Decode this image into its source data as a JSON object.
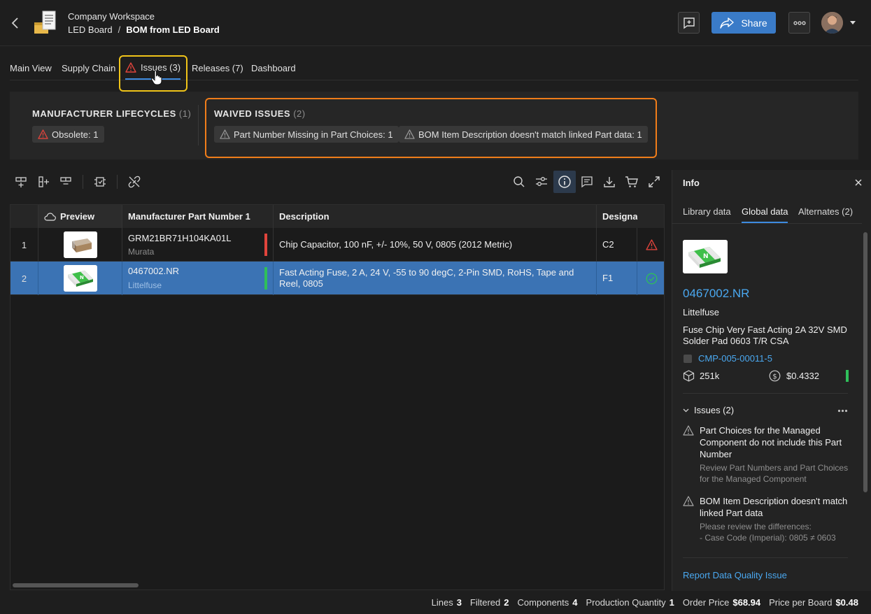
{
  "header": {
    "workspace": "Company Workspace",
    "project": "LED Board",
    "separator": "/",
    "document": "BOM from LED Board",
    "share_label": "Share"
  },
  "tabs": [
    {
      "label": "Main View"
    },
    {
      "label": "Supply Chain"
    },
    {
      "label": "Issues (3)"
    },
    {
      "label": "Releases (7)"
    },
    {
      "label": "Dashboard"
    }
  ],
  "summary": {
    "lifecycles_title": "MANUFACTURER LIFECYCLES",
    "lifecycles_count": "(1)",
    "lifecycle_chip": "Obsolete: 1",
    "waived_title": "WAIVED ISSUES",
    "waived_count": "(2)",
    "waived_chips": [
      "Part Number Missing in Part Choices: 1",
      "BOM Item Description doesn't match linked Part data: 1"
    ]
  },
  "table": {
    "columns": [
      "Preview",
      "Manufacturer Part Number 1",
      "Description",
      "Designat"
    ],
    "rows": [
      {
        "num": "1",
        "mpn": "GRM21BR71H104KA01L",
        "mfr": "Murata",
        "description": "Chip Capacitor, 100 nF, +/- 10%, 50 V, 0805 (2012 Metric)",
        "designator": "C2",
        "status": "error"
      },
      {
        "num": "2",
        "mpn": "0467002.NR",
        "mfr": "Littelfuse",
        "description": "Fast Acting Fuse, 2 A, 24 V, -55 to 90 degC, 2-Pin SMD, RoHS, Tape and Reel, 0805",
        "designator": "F1",
        "status": "ok"
      }
    ]
  },
  "info": {
    "title": "Info",
    "tabs": [
      "Library data",
      "Global data",
      "Alternates (2)"
    ],
    "part_number": "0467002.NR",
    "manufacturer": "Littelfuse",
    "description": "Fuse Chip Very Fast Acting 2A 32V SMD Solder Pad 0603 T/R CSA",
    "component_id": "CMP-005-00011-5",
    "stock": "251k",
    "price": "$0.4332",
    "issues_title": "Issues (2)",
    "issues": [
      {
        "title": "Part Choices for the Managed Component do not include this Part Number",
        "sub": "Review Part Numbers and Part Choices for the Managed Component"
      },
      {
        "title": "BOM Item Description doesn't match linked Part data",
        "sub": "Please review the differences:",
        "sub2": "- Case Code (Imperial): 0805 ≠ 0603"
      }
    ],
    "report_link": "Report Data Quality Issue"
  },
  "footer": {
    "lines_label": "Lines",
    "lines": "3",
    "filtered_label": "Filtered",
    "filtered": "2",
    "components_label": "Components",
    "components": "4",
    "prodqty_label": "Production Quantity",
    "prodqty": "1",
    "order_label": "Order Price",
    "order": "$68.94",
    "ppb_label": "Price per Board",
    "ppb": "$0.48"
  },
  "colors": {
    "accent": "#3a7bc8",
    "error": "#e0443c",
    "ok": "#2fbf5a",
    "highlight_tab": "#f0c419",
    "highlight_waived": "#f07d1a"
  },
  "icons": [
    "back-icon",
    "logo-icon",
    "comment-icon",
    "share-icon",
    "more-icon",
    "warning-icon",
    "search-icon",
    "filter-icon",
    "info-icon",
    "chat-icon",
    "download-icon",
    "cart-icon",
    "expand-icon",
    "close-icon",
    "cube-icon",
    "dollar-icon",
    "chevron-down-icon",
    "cloud-icon",
    "check-circle-icon"
  ]
}
